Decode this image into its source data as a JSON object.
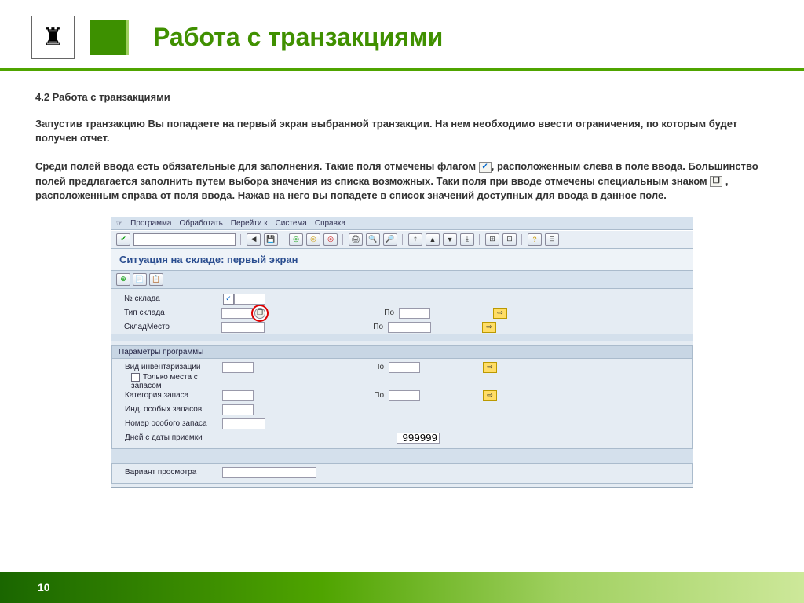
{
  "slide": {
    "title": "Работа с транзакциями",
    "section": "4.2 Работа с транзакциями",
    "para1": "Запустив транзакцию Вы попадаете на первый экран выбранной транзакции.  На нем необходимо ввести ограничения, по которым будет получен отчет.",
    "para2_a": "Среди полей ввода есть обязательные для заполнения. Такие поля отмечены флагом ",
    "para2_b": ", расположенным слева в поле ввода. Большинство полей предлагается заполнить путем выбора  значения из списка возможных. Таки поля при вводе отмечены специальным знаком ",
    "para2_c": " , расположенным справа от поля ввода. Нажав на него вы попадете в список значений доступных для ввода в данное поле.",
    "page": "10"
  },
  "sap": {
    "menu": [
      "Программа",
      "Обработать",
      "Перейти к",
      "Система",
      "Справка"
    ],
    "title": "Ситуация на складе: первый экран",
    "fields": {
      "warehouse_no": "№ склада",
      "storage_type": "Тип склада",
      "storage_bin": "СкладМесто",
      "to": "По",
      "groupbox": "Параметры программы",
      "inventory_type": "Вид инвентаризации",
      "only_with_stock": "Только места с запасом",
      "stock_category": "Категория запаса",
      "special_stock_ind": "Инд. особых запасов",
      "special_stock_no": "Номер особого запаса",
      "days_since": "Дней с даты приемки",
      "days_value": "999999",
      "display_variant": "Вариант просмотра"
    }
  },
  "icons": {
    "check": "✓",
    "help": "❐",
    "arrow": "⇨"
  }
}
